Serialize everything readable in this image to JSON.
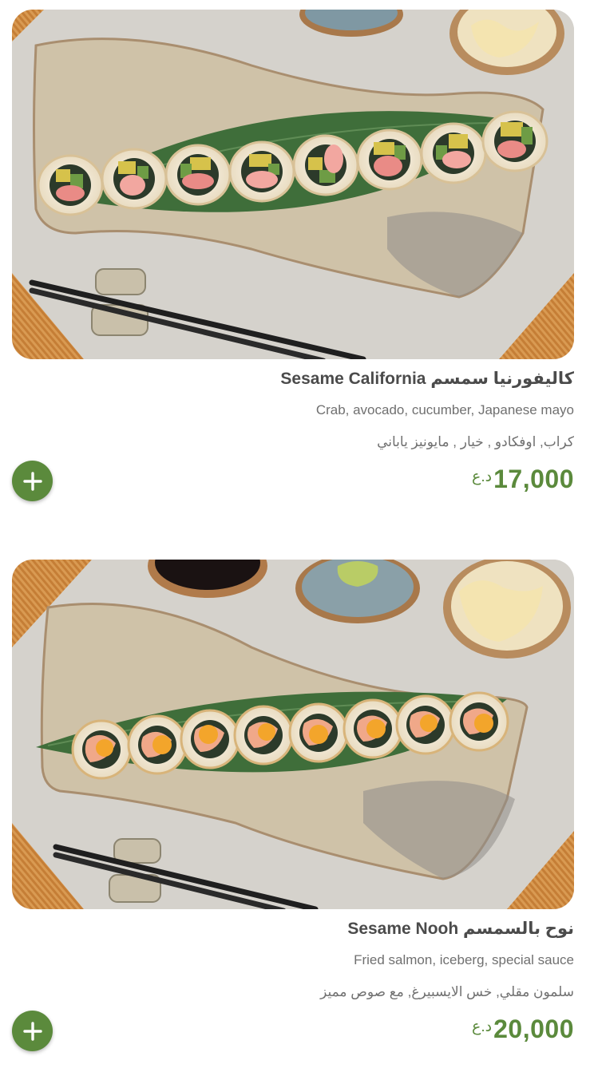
{
  "products": [
    {
      "title": "Sesame California كاليفورنيا سمسم",
      "description_en": "Crab, avocado, cucumber, Japanese mayo",
      "description_ar": "كراب, اوفكادو , خيار , مايونيز ياباني",
      "price": "17,000",
      "currency": "د.ع",
      "add_icon": "plus-icon",
      "image_alt": "sushi-roll-photo"
    },
    {
      "title": "Sesame Nooh نوح بالسمسم",
      "description_en": "Fried salmon, iceberg, special sauce",
      "description_ar": "سلمون مقلي, خس الايسبيرغ, مع صوص مميز",
      "price": "20,000",
      "currency": "د.ع",
      "add_icon": "plus-icon",
      "image_alt": "sushi-roll-photo"
    }
  ],
  "colors": {
    "accent": "#5b8a3c",
    "title": "#4b4b4b",
    "description": "#707070",
    "background": "#ffffff"
  }
}
